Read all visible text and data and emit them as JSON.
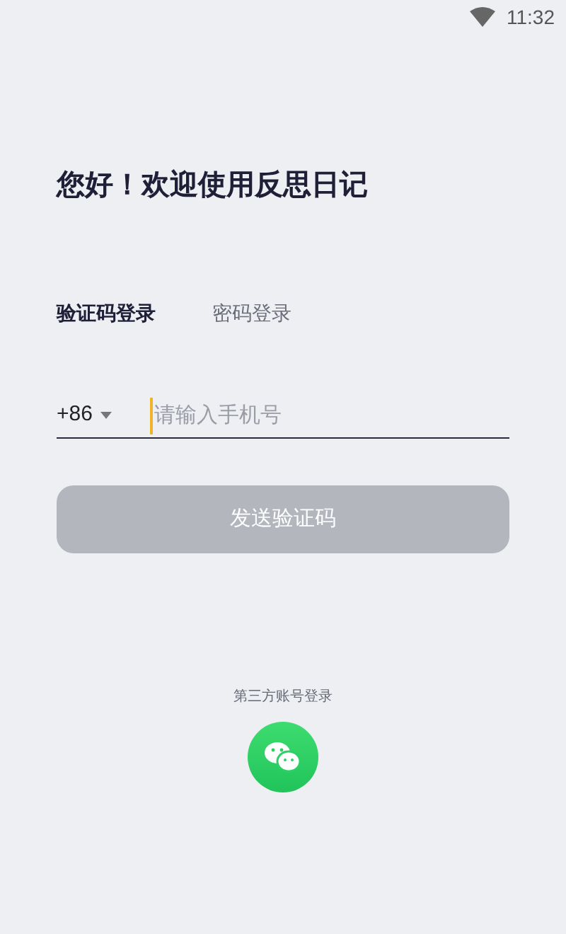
{
  "status_bar": {
    "time": "11:32"
  },
  "title": "您好！欢迎使用反思日记",
  "tabs": [
    {
      "label": "验证码登录",
      "selected": true
    },
    {
      "label": "密码登录",
      "selected": false
    }
  ],
  "phone_field": {
    "country_code": "+86",
    "placeholder": "请输入手机号",
    "focused": true
  },
  "send_button": {
    "label": "发送验证码",
    "disabled": true
  },
  "third_party": {
    "label": "第三方账号登录"
  }
}
